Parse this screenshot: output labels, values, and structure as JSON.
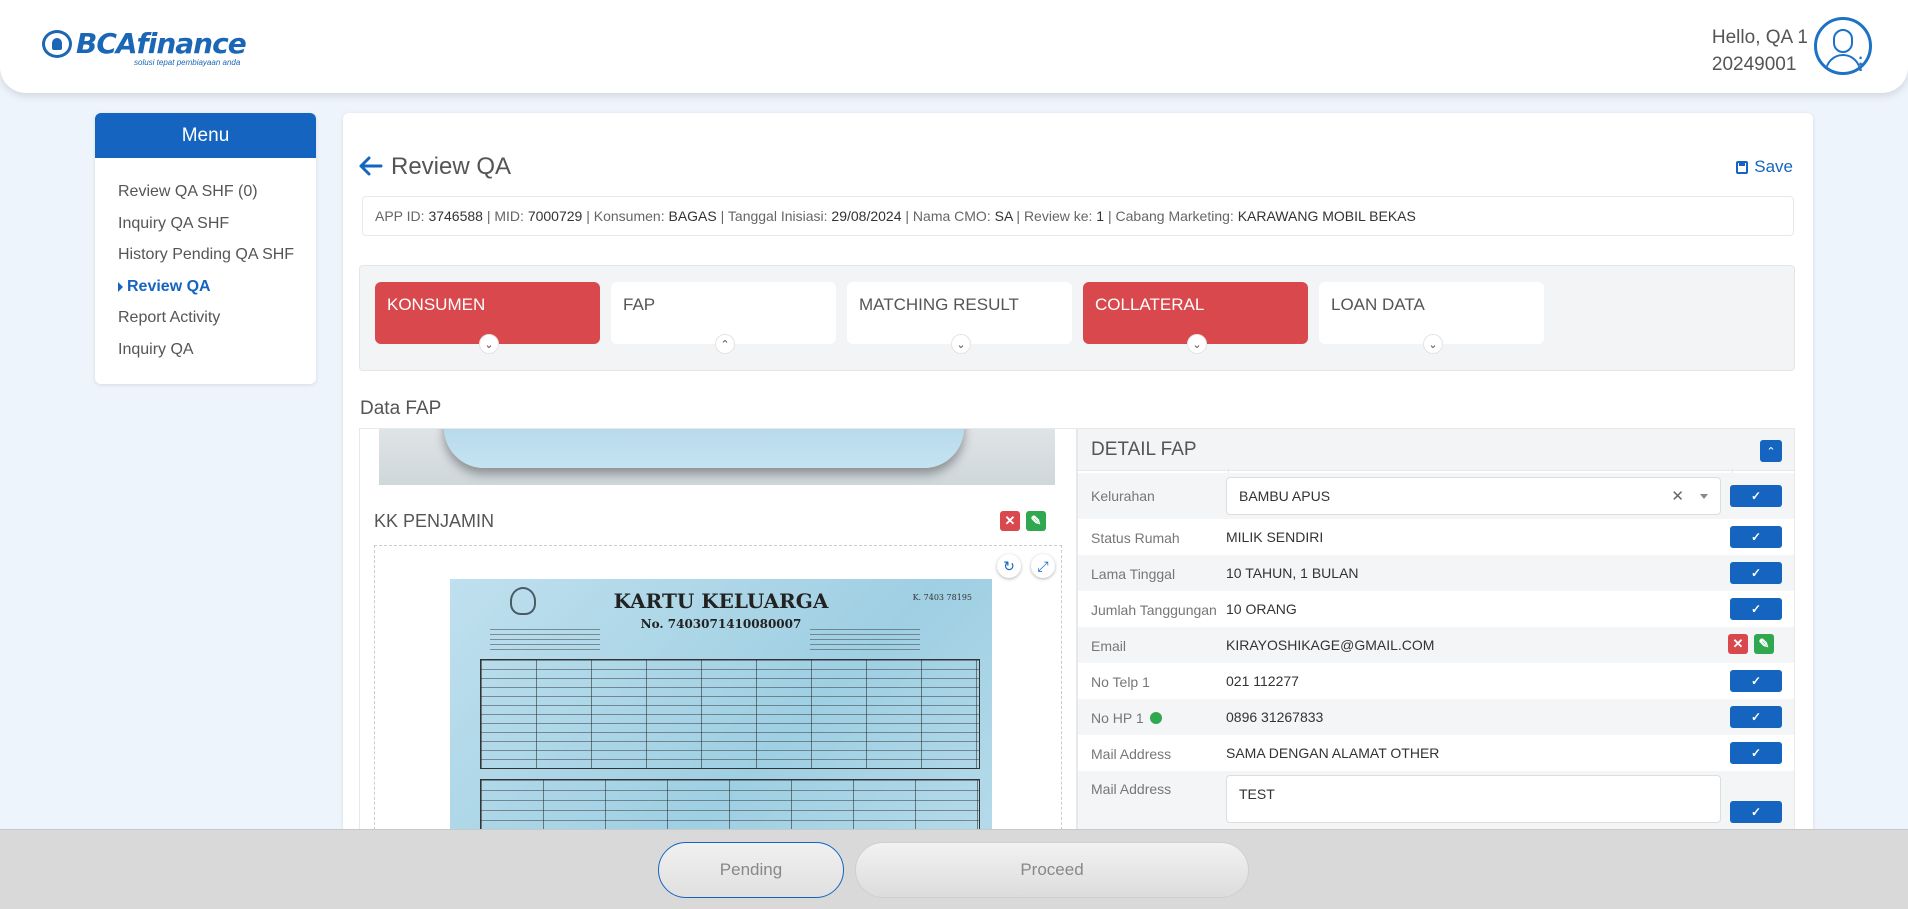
{
  "brand": {
    "name": "BCAfinance",
    "tagline": "solusi tepat pembiayaan anda"
  },
  "user": {
    "greeting": "Hello, QA 1",
    "id": "20249001"
  },
  "menu": {
    "title": "Menu",
    "items": [
      {
        "label": "Review QA SHF (0)"
      },
      {
        "label": "Inquiry QA SHF"
      },
      {
        "label": "History Pending QA SHF"
      },
      {
        "label": "Review QA",
        "active": true
      },
      {
        "label": "Report Activity"
      },
      {
        "label": "Inquiry QA"
      }
    ]
  },
  "page": {
    "title": "Review QA",
    "save_label": "Save"
  },
  "info": {
    "app_id_label": "APP ID:",
    "app_id": "3746588",
    "mid_label": "MID:",
    "mid": "7000729",
    "konsumen_label": "Konsumen:",
    "konsumen": "BAGAS",
    "tanggal_label": "Tanggal Inisiasi:",
    "tanggal": "29/08/2024",
    "cmo_label": "Nama CMO:",
    "cmo": "SA",
    "review_label": "Review ke:",
    "review": "1",
    "cabang_label": "Cabang Marketing:",
    "cabang": "KARAWANG MOBIL BEKAS"
  },
  "tabs": [
    {
      "label": "KONSUMEN",
      "state": "error",
      "chevron": "down"
    },
    {
      "label": "FAP",
      "state": "normal",
      "chevron": "up"
    },
    {
      "label": "MATCHING RESULT",
      "state": "normal",
      "chevron": "down"
    },
    {
      "label": "COLLATERAL",
      "state": "error",
      "chevron": "down"
    },
    {
      "label": "LOAN DATA",
      "state": "normal",
      "chevron": "down"
    }
  ],
  "section": {
    "title": "Data FAP"
  },
  "document": {
    "title": "KK PENJAMIN",
    "image_heading": "KARTU KELUARGA",
    "image_number": "No. 7403071410080007",
    "image_corner": "K. 7403 78195"
  },
  "detail": {
    "title": "DETAIL FAP",
    "rows": [
      {
        "label": "Kelurahan",
        "value": "BAMBU APUS"
      },
      {
        "label": "Status Rumah",
        "value": "MILIK SENDIRI"
      },
      {
        "label": "Lama Tinggal",
        "value": "10 TAHUN, 1 BULAN"
      },
      {
        "label": "Jumlah Tanggungan",
        "value": "10 ORANG"
      },
      {
        "label": "Email",
        "value": "KIRAYOSHIKAGE@GMAIL.COM"
      },
      {
        "label": "No Telp 1",
        "value": "021 112277"
      },
      {
        "label": "No HP 1",
        "value": "0896 31267833"
      },
      {
        "label": "Mail Address",
        "value": "SAMA DENGAN ALAMAT OTHER"
      },
      {
        "label": "Mail Address",
        "value": "TEST"
      }
    ]
  },
  "actions": {
    "pending_label": "Pending",
    "proceed_label": "Proceed"
  },
  "colors": {
    "primary": "#1565c0",
    "error": "#d9484c",
    "success": "#2fa84f"
  }
}
